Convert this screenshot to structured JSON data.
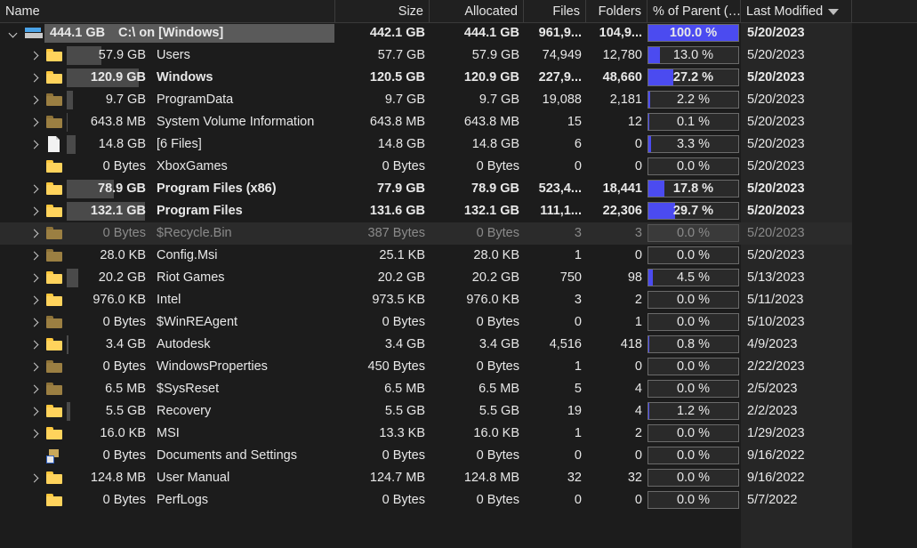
{
  "columns": {
    "name": "Name",
    "size": "Size",
    "allocated": "Allocated",
    "files": "Files",
    "folders": "Folders",
    "pct": "% of Parent (…",
    "modified": "Last Modified"
  },
  "colors": {
    "pct_fill": "#4b4bf0",
    "folder": "#ffc83d",
    "folder_dim": "#9b7f42"
  },
  "rows": [
    {
      "name": "C:\\  on  [Windows]",
      "total": "444.1 GB",
      "size": "442.1 GB",
      "allocated": "444.1 GB",
      "files": "961,9...",
      "folders": "104,9...",
      "pct_label": "100.0 %",
      "pct": 100.0,
      "modified": "5/20/2023",
      "icon": "drive-icon",
      "expand": "open",
      "bold": true,
      "root": true,
      "sizebar": 0
    },
    {
      "name": "Users",
      "total": "57.9 GB",
      "size": "57.7 GB",
      "allocated": "57.9 GB",
      "files": "74,949",
      "folders": "12,780",
      "pct_label": "13.0 %",
      "pct": 13.0,
      "modified": "5/20/2023",
      "icon": "folder-icon",
      "expand": "closed",
      "sizebar": 13.0
    },
    {
      "name": "Windows",
      "total": "120.9 GB",
      "size": "120.5 GB",
      "allocated": "120.9 GB",
      "files": "227,9...",
      "folders": "48,660",
      "pct_label": "27.2 %",
      "pct": 27.2,
      "modified": "5/20/2023",
      "icon": "folder-icon",
      "expand": "closed",
      "bold": true,
      "sizebar": 27.2
    },
    {
      "name": "ProgramData",
      "total": "9.7 GB",
      "size": "9.7 GB",
      "allocated": "9.7 GB",
      "files": "19,088",
      "folders": "2,181",
      "pct_label": "2.2 %",
      "pct": 2.2,
      "modified": "5/20/2023",
      "icon": "folder-dim-icon",
      "expand": "closed",
      "sizebar": 2.2
    },
    {
      "name": "System Volume Information",
      "total": "643.8 MB",
      "size": "643.8 MB",
      "allocated": "643.8 MB",
      "files": "15",
      "folders": "12",
      "pct_label": "0.1 %",
      "pct": 0.1,
      "modified": "5/20/2023",
      "icon": "folder-dim-icon",
      "expand": "closed",
      "sizebar": 0.1
    },
    {
      "name": "[6 Files]",
      "total": "14.8 GB",
      "size": "14.8 GB",
      "allocated": "14.8 GB",
      "files": "6",
      "folders": "0",
      "pct_label": "3.3 %",
      "pct": 3.3,
      "modified": "5/20/2023",
      "icon": "file-icon",
      "expand": "closed",
      "sizebar": 3.3
    },
    {
      "name": "XboxGames",
      "total": "0 Bytes",
      "size": "0 Bytes",
      "allocated": "0 Bytes",
      "files": "0",
      "folders": "0",
      "pct_label": "0.0 %",
      "pct": 0.0,
      "modified": "5/20/2023",
      "icon": "folder-icon",
      "expand": "none",
      "sizebar": 0
    },
    {
      "name": "Program Files (x86)",
      "total": "78.9 GB",
      "size": "77.9 GB",
      "allocated": "78.9 GB",
      "files": "523,4...",
      "folders": "18,441",
      "pct_label": "17.8 %",
      "pct": 17.8,
      "modified": "5/20/2023",
      "icon": "folder-icon",
      "expand": "closed",
      "bold": true,
      "sizebar": 17.8
    },
    {
      "name": "Program Files",
      "total": "132.1 GB",
      "size": "131.6 GB",
      "allocated": "132.1 GB",
      "files": "111,1...",
      "folders": "22,306",
      "pct_label": "29.7 %",
      "pct": 29.7,
      "modified": "5/20/2023",
      "icon": "folder-icon",
      "expand": "closed",
      "bold": true,
      "sizebar": 29.7
    },
    {
      "name": "$Recycle.Bin",
      "total": "0 Bytes",
      "size": "387 Bytes",
      "allocated": "0 Bytes",
      "files": "3",
      "folders": "3",
      "pct_label": "0.0 %",
      "pct": 0.0,
      "modified": "5/20/2023",
      "icon": "folder-dim-icon",
      "expand": "closed",
      "dim": true,
      "sizebar": 0
    },
    {
      "name": "Config.Msi",
      "total": "28.0 KB",
      "size": "25.1 KB",
      "allocated": "28.0 KB",
      "files": "1",
      "folders": "0",
      "pct_label": "0.0 %",
      "pct": 0.0,
      "modified": "5/20/2023",
      "icon": "folder-dim-icon",
      "expand": "closed",
      "sizebar": 0
    },
    {
      "name": "Riot Games",
      "total": "20.2 GB",
      "size": "20.2 GB",
      "allocated": "20.2 GB",
      "files": "750",
      "folders": "98",
      "pct_label": "4.5 %",
      "pct": 4.5,
      "modified": "5/13/2023",
      "icon": "folder-icon",
      "expand": "closed",
      "sizebar": 4.5
    },
    {
      "name": "Intel",
      "total": "976.0 KB",
      "size": "973.5 KB",
      "allocated": "976.0 KB",
      "files": "3",
      "folders": "2",
      "pct_label": "0.0 %",
      "pct": 0.0,
      "modified": "5/11/2023",
      "icon": "folder-icon",
      "expand": "closed",
      "sizebar": 0
    },
    {
      "name": "$WinREAgent",
      "total": "0 Bytes",
      "size": "0 Bytes",
      "allocated": "0 Bytes",
      "files": "0",
      "folders": "1",
      "pct_label": "0.0 %",
      "pct": 0.0,
      "modified": "5/10/2023",
      "icon": "folder-dim-icon",
      "expand": "closed",
      "sizebar": 0
    },
    {
      "name": "Autodesk",
      "total": "3.4 GB",
      "size": "3.4 GB",
      "allocated": "3.4 GB",
      "files": "4,516",
      "folders": "418",
      "pct_label": "0.8 %",
      "pct": 0.8,
      "modified": "4/9/2023",
      "icon": "folder-icon",
      "expand": "closed",
      "sizebar": 0.8
    },
    {
      "name": "WindowsProperties",
      "total": "0 Bytes",
      "size": "450 Bytes",
      "allocated": "0 Bytes",
      "files": "1",
      "folders": "0",
      "pct_label": "0.0 %",
      "pct": 0.0,
      "modified": "2/22/2023",
      "icon": "folder-dim-icon",
      "expand": "closed",
      "sizebar": 0
    },
    {
      "name": "$SysReset",
      "total": "6.5 MB",
      "size": "6.5 MB",
      "allocated": "6.5 MB",
      "files": "5",
      "folders": "4",
      "pct_label": "0.0 %",
      "pct": 0.0,
      "modified": "2/5/2023",
      "icon": "folder-dim-icon",
      "expand": "closed",
      "sizebar": 0
    },
    {
      "name": "Recovery",
      "total": "5.5 GB",
      "size": "5.5 GB",
      "allocated": "5.5 GB",
      "files": "19",
      "folders": "4",
      "pct_label": "1.2 %",
      "pct": 1.2,
      "modified": "2/2/2023",
      "icon": "folder-icon",
      "expand": "closed",
      "sizebar": 1.2
    },
    {
      "name": "MSI",
      "total": "16.0 KB",
      "size": "13.3 KB",
      "allocated": "16.0 KB",
      "files": "1",
      "folders": "2",
      "pct_label": "0.0 %",
      "pct": 0.0,
      "modified": "1/29/2023",
      "icon": "folder-icon",
      "expand": "closed",
      "sizebar": 0
    },
    {
      "name": "Documents and Settings",
      "total": "0 Bytes",
      "size": "0 Bytes",
      "allocated": "0 Bytes",
      "files": "0",
      "folders": "0",
      "pct_label": "0.0 %",
      "pct": 0.0,
      "modified": "9/16/2022",
      "icon": "shortcut-icon",
      "expand": "none",
      "sizebar": 0
    },
    {
      "name": "User Manual",
      "total": "124.8 MB",
      "size": "124.7 MB",
      "allocated": "124.8 MB",
      "files": "32",
      "folders": "32",
      "pct_label": "0.0 %",
      "pct": 0.0,
      "modified": "9/16/2022",
      "icon": "folder-icon",
      "expand": "closed",
      "sizebar": 0
    },
    {
      "name": "PerfLogs",
      "total": "0 Bytes",
      "size": "0 Bytes",
      "allocated": "0 Bytes",
      "files": "0",
      "folders": "0",
      "pct_label": "0.0 %",
      "pct": 0.0,
      "modified": "5/7/2022",
      "icon": "folder-icon",
      "expand": "none",
      "sizebar": 0
    }
  ]
}
